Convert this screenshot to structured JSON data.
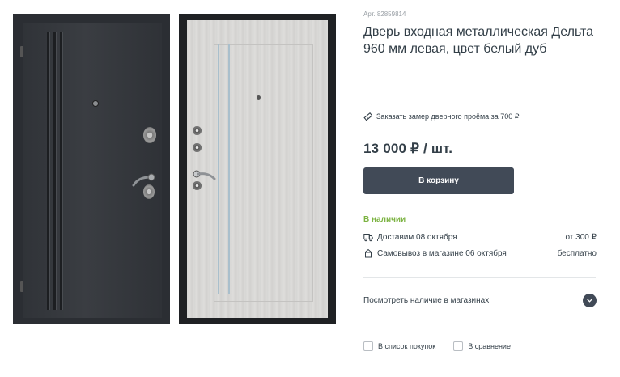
{
  "product": {
    "article": "Арт. 82859814",
    "title": "Дверь входная металлическая Дельта 960 мм левая, цвет белый дуб",
    "measure_link": "Заказать замер дверного проёма за 700 ₽",
    "price": "13 000 ₽ / шт.",
    "cart_button": "В корзину",
    "stock": "В наличии"
  },
  "delivery": {
    "courier_label": "Доставим 08 октября",
    "courier_price": "от 300 ₽",
    "pickup_label": "Самовывоз в магазине 06 октября",
    "pickup_price": "бесплатно"
  },
  "stores_link": "Посмотреть наличие в магазинах",
  "actions": {
    "shopping_list": "В список покупок",
    "compare": "В сравнение"
  },
  "colors": {
    "accent": "#414a57",
    "stock_green": "#7cb342",
    "text": "#333f48"
  },
  "icons": [
    "ruler-icon",
    "truck-icon",
    "store-icon",
    "chevron-down-icon"
  ]
}
